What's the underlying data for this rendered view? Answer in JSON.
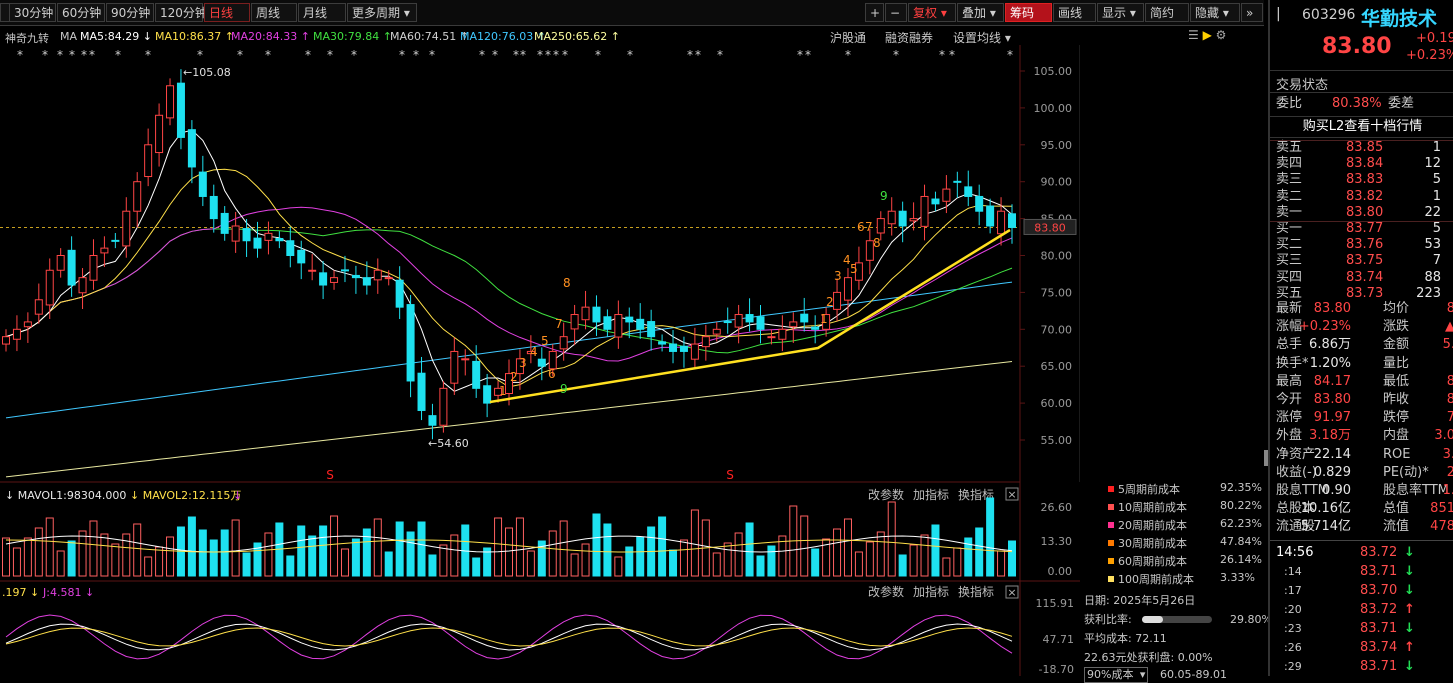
{
  "toolbar": {
    "periods": [
      "30分钟",
      "60分钟",
      "90分钟",
      "120分钟",
      "日线",
      "周线",
      "月线",
      "更多周期"
    ],
    "active_period": "日线",
    "right_buttons": [
      "+",
      "−",
      "复权",
      "叠加",
      "筹码",
      "画线",
      "显示",
      "简约",
      "隐藏"
    ],
    "hot_button": "筹码"
  },
  "ma_bar": {
    "items": [
      {
        "label": "神奇九转",
        "color": "#c8c8c8"
      },
      {
        "label": "MA",
        "color": "#c8c8c8"
      },
      {
        "label": "MA5:84.29 ↓",
        "color": "#ffffff"
      },
      {
        "label": "MA10:86.37 ↑",
        "color": "#ffe04a"
      },
      {
        "label": "MA20:84.33 ↑",
        "color": "#e040e0"
      },
      {
        "label": "MA30:79.84 ↑",
        "color": "#40e040"
      },
      {
        "label": "MA60:74.51 ↑",
        "color": "#d0d0d0"
      },
      {
        "label": "MA120:76.03 ↑",
        "color": "#40c8ff"
      },
      {
        "label": "MA250:65.62 ↑",
        "color": "#ffffa0"
      }
    ],
    "links": [
      "沪股通",
      "融资融券",
      "设置均线"
    ]
  },
  "price_axis": [
    "105.00",
    "100.00",
    "95.00",
    "90.00",
    "85.00",
    "80.00",
    "75.00",
    "70.00",
    "65.00",
    "60.00",
    "55.00"
  ],
  "current_price_tag": "83.80",
  "annotations": {
    "high": "105.08",
    "low": "54.60"
  },
  "nine_turn_labels": [
    "1",
    "2",
    "3",
    "4",
    "5",
    "6",
    "7",
    "8",
    "9"
  ],
  "vol_panel": {
    "title1": "MAVOL1:98304.000",
    "title2": "MAVOL2:12.115万",
    "buttons": [
      "改参数",
      "加指标",
      "换指标"
    ],
    "axis": [
      "26.60",
      "13.30",
      "0.00"
    ]
  },
  "kdj_panel": {
    "title1": ".197",
    "title2": "J:4.581",
    "buttons": [
      "改参数",
      "加指标",
      "换指标"
    ],
    "axis": [
      "115.91",
      "47.71",
      "-18.70"
    ]
  },
  "cost_legend": [
    {
      "label": "5周期前成本",
      "value": "92.35%",
      "color": "#ff2020"
    },
    {
      "label": "10周期前成本",
      "value": "80.22%",
      "color": "#ff5050"
    },
    {
      "label": "20周期前成本",
      "value": "62.23%",
      "color": "#ff3090"
    },
    {
      "label": "30周期前成本",
      "value": "47.84%",
      "color": "#ff7a00"
    },
    {
      "label": "60周期前成本",
      "value": "26.14%",
      "color": "#ffa000"
    },
    {
      "label": "100周期前成本",
      "value": "3.33%",
      "color": "#ffe060"
    }
  ],
  "chip_info": {
    "date": "日期: 2025年5月26日",
    "profit_label": "获利比率:",
    "profit_value": "29.80%",
    "avg_cost": "平均成本: 72.11",
    "profit_at": "22.63元处获利盘: 0.00%",
    "cost_select": "90%成本",
    "cost_range": "60.05-89.01"
  },
  "quote": {
    "code": "603296",
    "name": "华勤技术",
    "price": "83.80",
    "change": "+0.19",
    "change_pct": "+0.23%",
    "status_label": "交易状态",
    "weibi_label": "委比",
    "weibi": "80.38%",
    "weicha_label": "委差",
    "l2_link": "购买L2查看十档行情",
    "asks": [
      {
        "label": "卖五",
        "price": "83.85",
        "vol": "1"
      },
      {
        "label": "卖四",
        "price": "83.84",
        "vol": "12"
      },
      {
        "label": "卖三",
        "price": "83.83",
        "vol": "5"
      },
      {
        "label": "卖二",
        "price": "83.82",
        "vol": "1"
      },
      {
        "label": "卖一",
        "price": "83.80",
        "vol": "22"
      }
    ],
    "bids": [
      {
        "label": "买一",
        "price": "83.77",
        "vol": "5"
      },
      {
        "label": "买二",
        "price": "83.76",
        "vol": "53"
      },
      {
        "label": "买三",
        "price": "83.75",
        "vol": "7"
      },
      {
        "label": "买四",
        "price": "83.74",
        "vol": "88"
      },
      {
        "label": "买五",
        "price": "83.73",
        "vol": "223"
      }
    ],
    "stats": [
      {
        "l1": "最新",
        "v1": "83.80",
        "c1": "red",
        "l2": "均价",
        "v2": "8"
      },
      {
        "l1": "涨幅",
        "v1": "+0.23%",
        "c1": "red",
        "l2": "涨跌",
        "v2": "▲"
      },
      {
        "l1": "总手",
        "v1": "6.86万",
        "c1": "white",
        "l2": "金额",
        "v2": "5."
      },
      {
        "l1": "换手*",
        "v1": "1.20%",
        "c1": "white",
        "l2": "量比",
        "v2": ""
      },
      {
        "l1": "最高",
        "v1": "84.17",
        "c1": "red",
        "l2": "最低",
        "v2": "8"
      },
      {
        "l1": "今开",
        "v1": "83.80",
        "c1": "red",
        "l2": "昨收",
        "v2": "8"
      },
      {
        "l1": "涨停",
        "v1": "91.97",
        "c1": "red",
        "l2": "跌停",
        "v2": "7"
      },
      {
        "l1": "外盘",
        "v1": "3.18万",
        "c1": "red",
        "l2": "内盘",
        "v2": "3.0"
      },
      {
        "l1": "净资产",
        "v1": "22.14",
        "c1": "white",
        "l2": "ROE",
        "v2": "3."
      },
      {
        "l1": "收益(-)",
        "v1": "0.829",
        "c1": "white",
        "l2": "PE(动)*",
        "v2": "2"
      },
      {
        "l1": "股息TTM",
        "v1": "0.90",
        "c1": "white",
        "l2": "股息率TTM",
        "v2": "1."
      },
      {
        "l1": "总股本",
        "v1": "10.16亿",
        "c1": "white",
        "l2": "总值",
        "v2": "851"
      },
      {
        "l1": "流通股",
        "v1": "5.714亿",
        "c1": "white",
        "l2": "流值",
        "v2": "478"
      }
    ],
    "ticks": [
      {
        "time": "14:56",
        "price": "83.72",
        "dir": "↓"
      },
      {
        "time": ":14",
        "price": "83.71",
        "dir": "↓"
      },
      {
        "time": ":17",
        "price": "83.70",
        "dir": "↓"
      },
      {
        "time": ":20",
        "price": "83.72",
        "dir": "↑"
      },
      {
        "time": ":23",
        "price": "83.71",
        "dir": "↓"
      },
      {
        "time": ":26",
        "price": "83.74",
        "dir": "↑"
      },
      {
        "time": ":29",
        "price": "83.71",
        "dir": "↓"
      }
    ]
  }
}
